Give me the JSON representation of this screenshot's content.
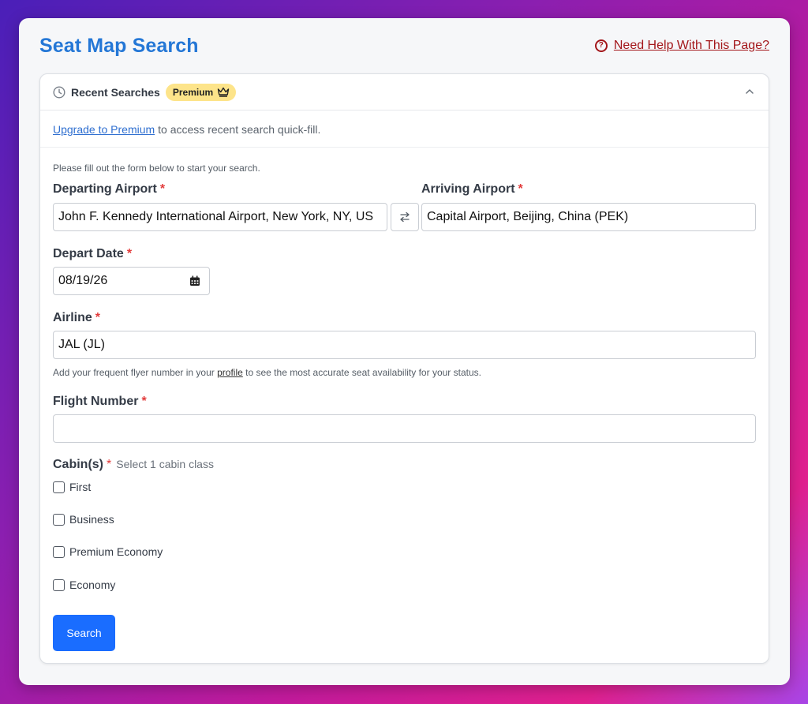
{
  "page": {
    "title": "Seat Map Search",
    "help_link": "Need Help With This Page?"
  },
  "recent": {
    "title": "Recent Searches",
    "badge": "Premium",
    "upgrade_link": "Upgrade to Premium",
    "upgrade_text": "to access recent search quick-fill."
  },
  "form": {
    "intro": "Please fill out the form below to start your search.",
    "required_marker": "*",
    "departing": {
      "label": "Departing Airport",
      "value": "John F. Kennedy International Airport, New York, NY, US"
    },
    "arriving": {
      "label": "Arriving Airport",
      "value": "Capital Airport, Beijing, China (PEK)"
    },
    "depart_date": {
      "label": "Depart Date",
      "value": "08/19/26"
    },
    "airline": {
      "label": "Airline",
      "value": "JAL (JL)",
      "hint_before": "Add your frequent flyer number in your",
      "hint_link": "profile",
      "hint_after": "to see the most accurate seat availability for your status."
    },
    "flight_number": {
      "label": "Flight Number",
      "value": ""
    },
    "cabins": {
      "label": "Cabin(s)",
      "sublabel": "Select 1 cabin class",
      "options": [
        {
          "label": "First",
          "checked": false
        },
        {
          "label": "Business",
          "checked": false
        },
        {
          "label": "Premium Economy",
          "checked": false
        },
        {
          "label": "Economy",
          "checked": false
        }
      ]
    },
    "search_button": "Search"
  },
  "icons": {
    "help": "help-circle-icon",
    "clock": "clock-icon",
    "crown": "crown-icon",
    "chevron": "chevron-up-icon",
    "swap": "swap-icon",
    "calendar": "calendar-icon"
  },
  "colors": {
    "title": "#2477d6",
    "help_link": "#a3161a",
    "badge_bg": "#fde48a",
    "required": "#e23b3b",
    "primary_button": "#1a6dff"
  }
}
